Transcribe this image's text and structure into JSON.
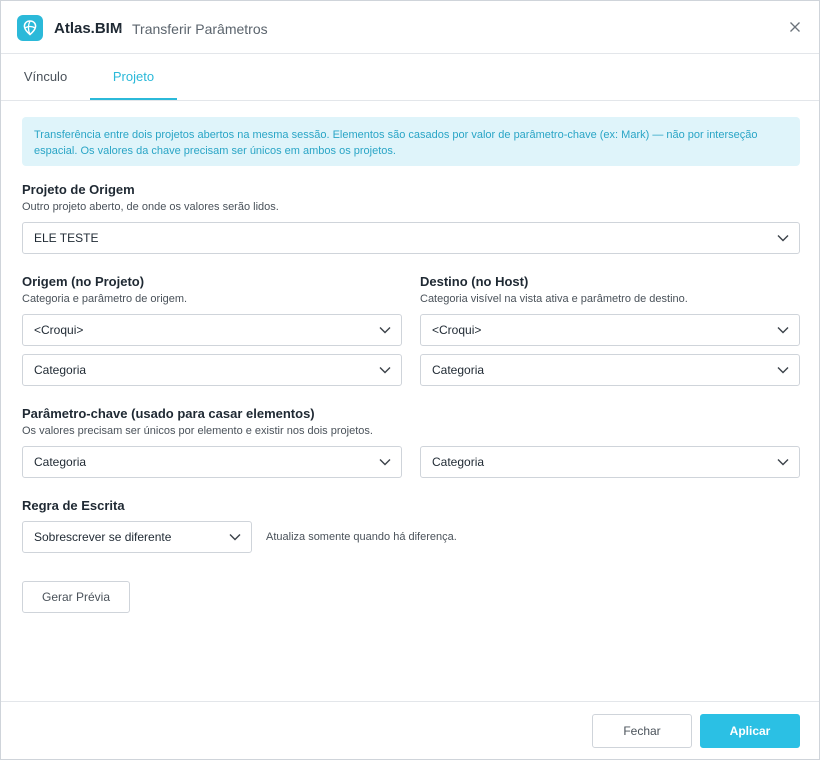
{
  "titlebar": {
    "app_name": "Atlas.BIM",
    "separator": "·",
    "title": "Transferir Parâmetros",
    "logo_icon": "atlas-logo-icon",
    "close_icon": "close-icon"
  },
  "tabs": [
    {
      "label": "Vínculo",
      "active": false
    },
    {
      "label": "Projeto",
      "active": true
    }
  ],
  "info": {
    "text": "Transferência entre dois projetos abertos na mesma sessão. Elementos são casados por valor de parâmetro-chave (ex: Mark) — não por interseção espacial. Os valores da chave precisam ser únicos em ambos os projetos."
  },
  "origin_project": {
    "title": "Projeto de Origem",
    "subtitle": "Outro projeto aberto, de onde os valores serão lidos.",
    "value": "ELE TESTE"
  },
  "source": {
    "title": "Origem (no Projeto)",
    "subtitle": "Categoria e parâmetro de origem.",
    "category": "<Croqui>",
    "parameter": "Categoria"
  },
  "target": {
    "title": "Destino (no Host)",
    "subtitle": "Categoria visível na vista ativa e parâmetro de destino.",
    "category": "<Croqui>",
    "parameter": "Categoria"
  },
  "key_param": {
    "title": "Parâmetro-chave (usado para casar elementos)",
    "subtitle": "Os valores precisam ser únicos por elemento e existir nos dois projetos.",
    "source_value": "Categoria",
    "target_value": "Categoria"
  },
  "write_rule": {
    "title": "Regra de Escrita",
    "value": "Sobrescrever se diferente",
    "hint": "Atualiza somente quando há diferença."
  },
  "actions": {
    "preview": "Gerar Prévia",
    "close": "Fechar",
    "apply": "Aplicar"
  },
  "colors": {
    "accent": "#2bc0e4",
    "info_bg": "#dff4fa",
    "info_text": "#2aa5c6"
  }
}
